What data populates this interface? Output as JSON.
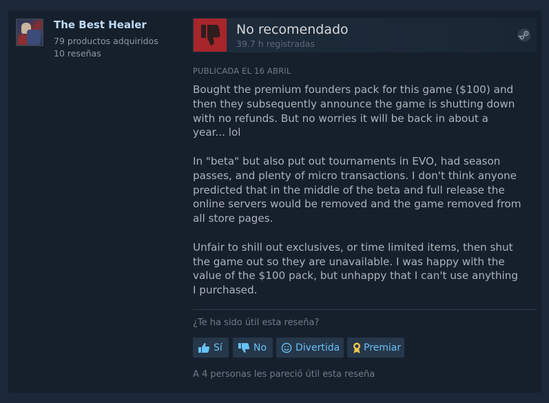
{
  "author": {
    "name": "The Best Healer",
    "products": "79 productos adquiridos",
    "reviews": "10 reseñas"
  },
  "review": {
    "verdict": "No recomendado",
    "hours": "39.7 h registradas",
    "posted": "PUBLICADA EL 16 ABRIL",
    "paragraphs": [
      "Bought the premium founders pack for this game ($100) and then they subsequently announce the game is shutting down with no refunds. But no worries it will be back in about a year... lol",
      "In \"beta\" but also put out tournaments in EVO, had season passes, and plenty of micro transactions. I don't think anyone predicted that in the middle of the beta and full release the online servers would be removed and the game removed from all store pages.",
      "Unfair to shill out exclusives, or time limited items, then shut the game out so they are unavailable. I was happy with the value of the $100 pack, but unhappy that I can't use anything I purchased."
    ]
  },
  "feedback": {
    "question": "¿Te ha sido útil esta reseña?",
    "yes_label": "Sí",
    "no_label": "No",
    "funny_label": "Divertida",
    "award_label": "Premiar",
    "helpful_count": "A 4 personas les pareció útil esta reseña"
  },
  "icons": {
    "verdict": "thumbs-down-icon",
    "platform": "steam-icon",
    "yes": "thumbs-up-icon",
    "no": "thumbs-down-icon",
    "funny": "smiley-icon",
    "award": "award-icon"
  },
  "colors": {
    "negative": "#a7262a",
    "link": "#67c1f5",
    "author_name": "#c1dbf4",
    "award": "#f2c94c"
  }
}
